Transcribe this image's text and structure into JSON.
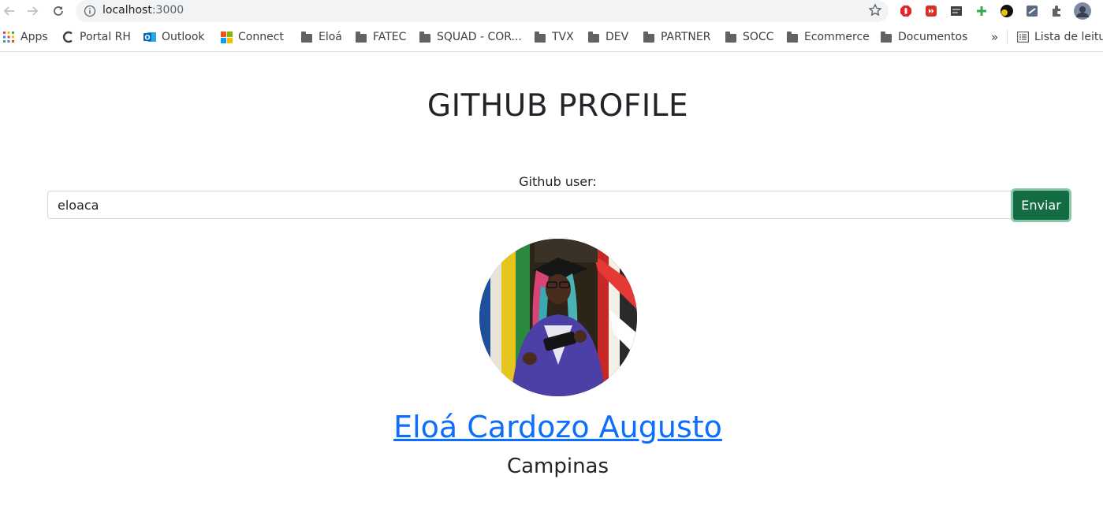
{
  "browser": {
    "url_host": "localhost",
    "url_port": ":3000",
    "bookmarks": [
      {
        "label": "Apps",
        "icon": "apps-grid-icon"
      },
      {
        "label": "Portal RH",
        "icon": "portal-rh-icon"
      },
      {
        "label": "Outlook",
        "icon": "outlook-icon"
      },
      {
        "label": "Connect",
        "icon": "microsoft-icon"
      },
      {
        "label": "Eloá",
        "icon": "folder-icon"
      },
      {
        "label": "FATEC",
        "icon": "folder-icon"
      },
      {
        "label": "SQUAD - COR...",
        "icon": "folder-icon"
      },
      {
        "label": "TVX",
        "icon": "folder-icon"
      },
      {
        "label": "DEV",
        "icon": "folder-icon"
      },
      {
        "label": "PARTNER",
        "icon": "folder-icon"
      },
      {
        "label": "SOCC",
        "icon": "folder-icon"
      },
      {
        "label": "Ecommerce",
        "icon": "folder-icon"
      },
      {
        "label": "Documentos",
        "icon": "folder-icon"
      }
    ],
    "overflow_label": "»",
    "reading_list_label": "Lista de leitu"
  },
  "page": {
    "title": "GITHUB PROFILE",
    "form_label": "Github user:",
    "input_value": "eloaca",
    "submit_label": "Enviar",
    "profile_name": "Eloá Cardozo Augusto",
    "profile_location": "Campinas"
  },
  "colors": {
    "submit_bg": "#146c43",
    "link": "#0d6efd"
  }
}
